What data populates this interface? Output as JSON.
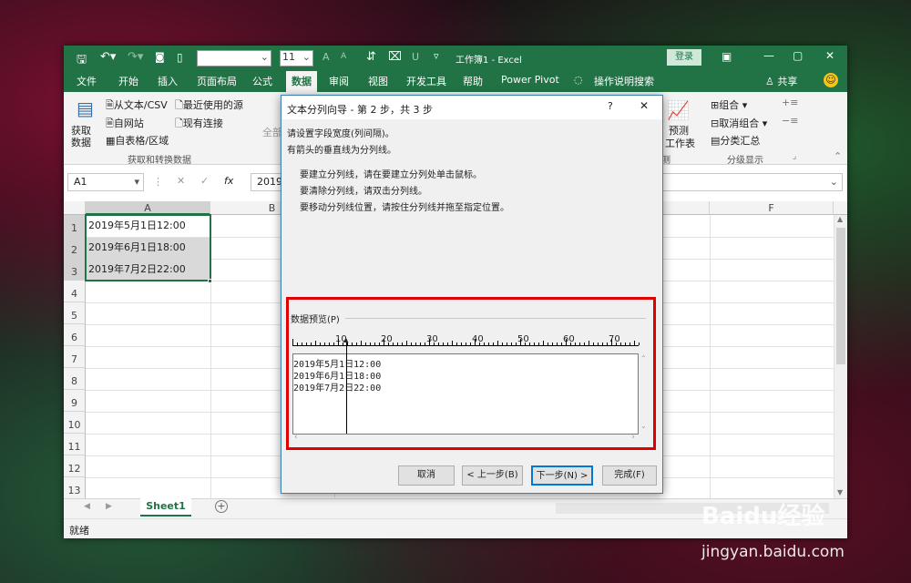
{
  "window": {
    "title": "工作簿1 - Excel",
    "login_label": "登录",
    "share_label": "共享",
    "font_name": "",
    "font_size": "11",
    "font_grow": "A",
    "font_shrink": "A"
  },
  "tabs": [
    "文件",
    "开始",
    "插入",
    "页面布局",
    "公式",
    "数据",
    "审阅",
    "视图",
    "开发工具",
    "帮助",
    "Power Pivot",
    "操作说明搜索"
  ],
  "ribbon": {
    "get_data": "获取数据",
    "from_text": "从文本/CSV",
    "from_web": "自网站",
    "from_table": "自表格/区域",
    "recent_sources": "最近使用的源",
    "existing_connections": "现有连接",
    "group_get_transform": "获取和转换数据",
    "refresh_all": "全部",
    "forecast": "预测",
    "forecast_sheet": "工作表",
    "forecast_group_tail": "测",
    "group_label": "组合",
    "ungroup_label": "取消组合",
    "subtotal_label": "分类汇总",
    "outline_group": "分级显示"
  },
  "formula_bar": {
    "name_box": "A1",
    "fx": "fx",
    "value": "2019"
  },
  "columns": [
    "A",
    "B",
    "F"
  ],
  "rows": [
    "1",
    "2",
    "3",
    "4",
    "5",
    "6",
    "7",
    "8",
    "9",
    "10",
    "11",
    "12",
    "13"
  ],
  "cells": [
    "2019年5月1日12:00",
    "2019年6月1日18:00",
    "2019年7月2日22:00"
  ],
  "sheet_tab": "Sheet1",
  "status_text": "就绪",
  "dialog": {
    "title": "文本分列向导 - 第 2 步，共 3 步",
    "help": "?",
    "close": "✕",
    "line1": "请设置字段宽度(列间隔)。",
    "line2": "有箭头的垂直线为分列线。",
    "instr1": "要建立分列线，请在要建立分列处单击鼠标。",
    "instr2": "要清除分列线，请双击分列线。",
    "instr3": "要移动分列线位置，请按住分列线并拖至指定位置。",
    "preview_label": "数据预览(P)",
    "ruler": [
      "10",
      "20",
      "30",
      "40",
      "50",
      "60",
      "70"
    ],
    "preview_rows": [
      "2019年5月1日12:00",
      "2019年6月1日18:00",
      "2019年7月2日22:00"
    ],
    "cancel": "取消",
    "back": "< 上一步(B)",
    "next": "下一步(N) >",
    "finish": "完成(F)"
  },
  "watermark": {
    "brand": "Baidu经验",
    "url": "jingyan.baidu.com"
  },
  "colors": {
    "excel_green": "#217346",
    "highlight_red": "#e00000",
    "dialog_border": "#3c7fb1"
  }
}
